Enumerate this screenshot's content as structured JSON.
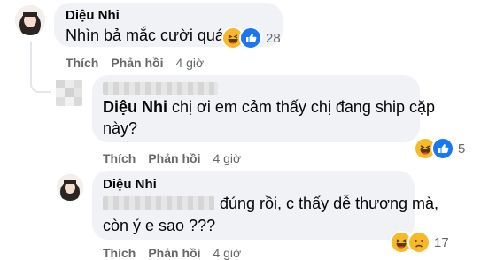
{
  "comments": [
    {
      "author": "Diệu Nhi",
      "text_lines": [
        "Nhìn bả mắc cười quá"
      ],
      "reactions": [
        "haha-icon",
        "like-icon"
      ],
      "reaction_count": "28",
      "actions": {
        "like": "Thích",
        "reply": "Phản hồi",
        "time": "4 giờ"
      }
    },
    {
      "author_hidden": true,
      "mention": "Diệu Nhi",
      "text_lines": [
        "chị ơi em cảm thấy chị đang ship cặp",
        "này?"
      ],
      "reactions": [
        "haha-icon",
        "like-icon"
      ],
      "reaction_count": "5",
      "actions": {
        "like": "Thích",
        "reply": "Phản hồi",
        "time": "4 giờ"
      }
    },
    {
      "author": "Diệu Nhi",
      "text_lines": [
        "đúng rồi, c thấy dễ thương mà,",
        "còn ý e sao ???"
      ],
      "reactions": [
        "haha-icon",
        "sad-icon"
      ],
      "reaction_count": "17",
      "actions": {
        "like": "Thích",
        "reply": "Phản hồi",
        "time": "4 giờ"
      }
    }
  ],
  "colors": {
    "bubble": "#f0f2f5",
    "secondary_text": "#65676b",
    "like_blue": "#1877f2",
    "haha_yellow": "#f7b928"
  }
}
